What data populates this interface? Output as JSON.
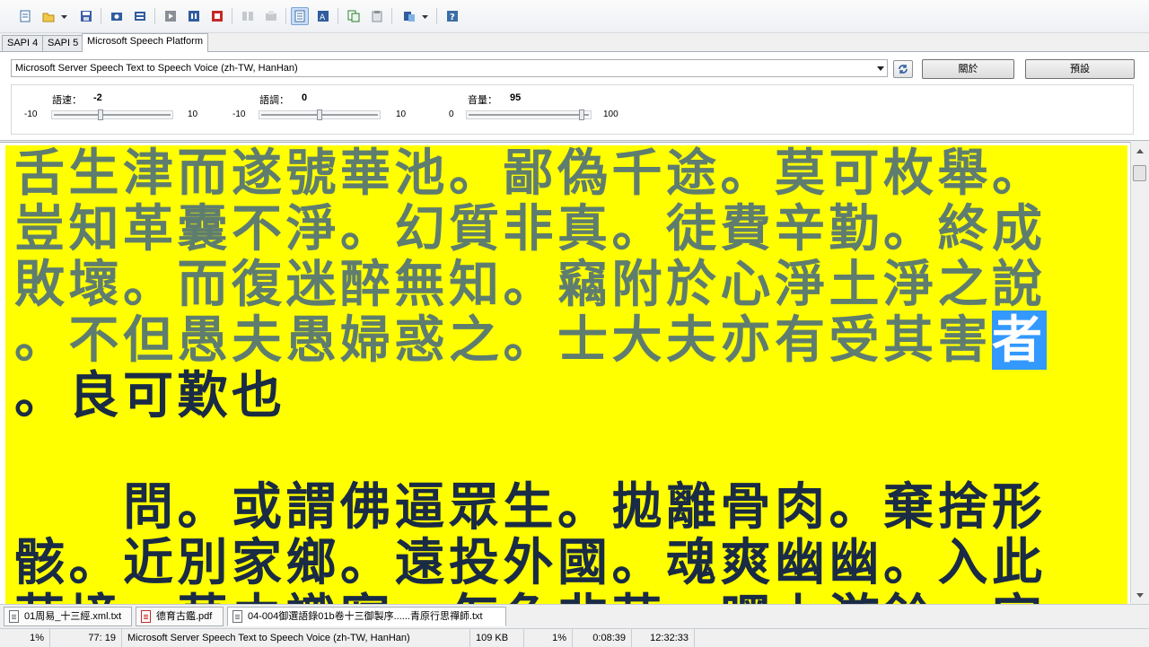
{
  "toolbar": {
    "icons": [
      "new-file-icon",
      "open-folder-icon",
      "dropdown-arrow-icon",
      "save-icon",
      "export-audio-icon",
      "batch-export-icon",
      "play-icon",
      "pause-icon",
      "stop-icon",
      "split-icon",
      "merge-icon",
      "read-mode-icon",
      "text-mode-icon",
      "copy-icon",
      "paste-icon",
      "convert-icon",
      "menu-dropdown-icon",
      "help-icon"
    ]
  },
  "tabs": [
    {
      "label": "SAPI 4"
    },
    {
      "label": "SAPI 5"
    },
    {
      "label": "Microsoft Speech Platform",
      "selected": true
    }
  ],
  "voice": {
    "selected": "Microsoft Server Speech Text to Speech Voice (zh-TW, HanHan)",
    "about_label": "關於",
    "default_label": "預設"
  },
  "sliders": {
    "rate": {
      "label": "語速：",
      "value": "-2",
      "min": "-10",
      "max": "10",
      "level": -2,
      "range": [
        -10,
        10
      ]
    },
    "pitch": {
      "label": "語調：",
      "value": "0",
      "min": "-10",
      "max": "10",
      "level": 0,
      "range": [
        -10,
        10
      ]
    },
    "volume": {
      "label": "音量：",
      "value": "95",
      "min": "0",
      "max": "100",
      "level": 95,
      "range": [
        0,
        100
      ]
    }
  },
  "document": {
    "lines": [
      {
        "read": "舌生津而遂號華池。鄙偽千途。莫可枚舉。"
      },
      {
        "read": "豈知革囊不淨。幻質非真。徒費辛勤。終成"
      },
      {
        "read": "敗壞。而復迷醉無知。竊附於心淨土淨之說"
      },
      {
        "read": "。不但愚夫愚婦惑之。士大夫亦有受其害",
        "highlight": "者"
      },
      {
        "unread": "。良可歎也"
      },
      {
        "unread": ""
      },
      {
        "unread": "　　問。或謂佛逼眾生。拋離骨肉。棄捨形"
      },
      {
        "unread": "骸。近別家鄉。遠投外國。魂爽幽幽。入此"
      },
      {
        "unread": "茫境。莫由識寤。怎免非苦。嘿上游鈴。宜"
      }
    ]
  },
  "doc_tabs": [
    {
      "label": "01周易_十三經.xml.txt",
      "type": "txt"
    },
    {
      "label": "德育古鑑.pdf",
      "type": "pdf"
    },
    {
      "label": "04-004御選語錄01b卷十三御製序......青原行思禪師.txt",
      "type": "txt",
      "selected": true
    }
  ],
  "status": {
    "percent1": "1%",
    "position": "77:  19",
    "voice": "Microsoft Server Speech Text to Speech Voice (zh-TW, HanHan)",
    "size": "109 KB",
    "percent2": "1%",
    "elapsed": "0:08:39",
    "clock": "12:32:33"
  }
}
